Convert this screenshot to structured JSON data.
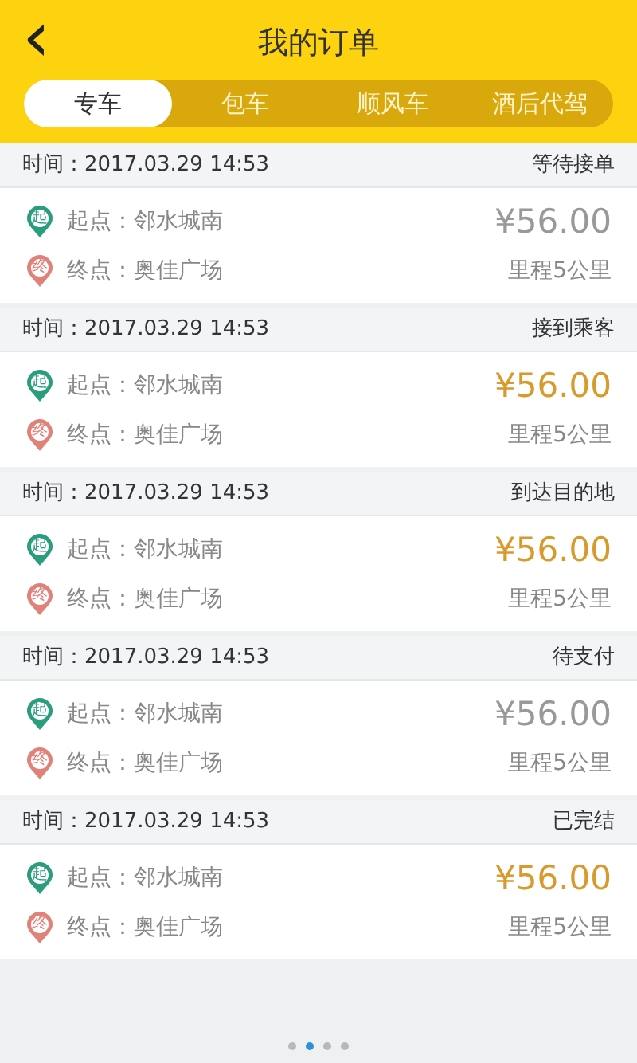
{
  "header": {
    "back_icon": "‹",
    "title": "我的订单"
  },
  "tabs": [
    {
      "label": "专车",
      "selected": true
    },
    {
      "label": "包车",
      "selected": false
    },
    {
      "label": "顺风车",
      "selected": false
    },
    {
      "label": "酒后代驾",
      "selected": false
    }
  ],
  "orders": [
    {
      "time": "时间：2017.03.29  14:53",
      "status": "等待接单",
      "start_badge": "起",
      "start": "起点：邻水城南",
      "end_badge": "终",
      "end": "终点：奥佳广场",
      "price": "¥56.00",
      "price_highlighted": false,
      "distance": "里程5公里"
    },
    {
      "time": "时间：2017.03.29  14:53",
      "status": "接到乘客",
      "start_badge": "起",
      "start": "起点：邻水城南",
      "end_badge": "终",
      "end": "终点：奥佳广场",
      "price": "¥56.00",
      "price_highlighted": true,
      "distance": "里程5公里"
    },
    {
      "time": "时间：2017.03.29  14:53",
      "status": "到达目的地",
      "start_badge": "起",
      "start": "起点：邻水城南",
      "end_badge": "终",
      "end": "终点：奥佳广场",
      "price": "¥56.00",
      "price_highlighted": true,
      "distance": "里程5公里"
    },
    {
      "time": "时间：2017.03.29  14:53",
      "status": "待支付",
      "start_badge": "起",
      "start": "起点：邻水城南",
      "end_badge": "终",
      "end": "终点：奥佳广场",
      "price": "¥56.00",
      "price_highlighted": false,
      "distance": "里程5公里"
    },
    {
      "time": "时间：2017.03.29  14:53",
      "status": "已完结",
      "start_badge": "起",
      "start": "起点：邻水城南",
      "end_badge": "终",
      "end": "终点：奥佳广场",
      "price": "¥56.00",
      "price_highlighted": true,
      "distance": "里程5公里"
    }
  ],
  "page_dots": [
    {
      "selected": false
    },
    {
      "selected": true
    },
    {
      "selected": false
    },
    {
      "selected": false
    }
  ]
}
